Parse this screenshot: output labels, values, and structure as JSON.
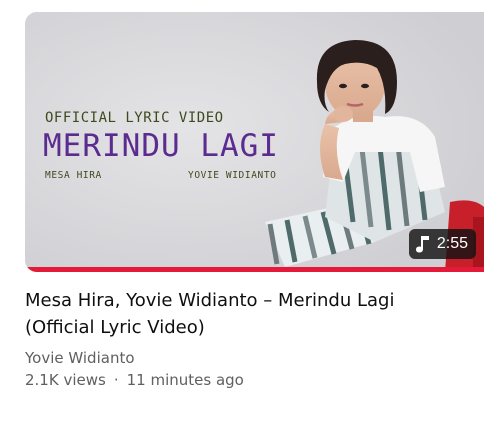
{
  "thumbnail": {
    "tag_line": "OFFICIAL LYRIC VIDEO",
    "song_title": "MERINDU LAGI",
    "artist_left": "MESA HIRA",
    "artist_right": "YOVIE WIDIANTO",
    "duration": "2:55",
    "duration_icon": "music-note-icon",
    "progress_fraction": 1.0,
    "progress_color": "#e5193a",
    "title_color": "#5b2b8f"
  },
  "video": {
    "title": "Mesa Hira, Yovie Widianto – Merindu Lagi (Official Lyric Video)",
    "channel": "Yovie Widianto",
    "views": "2.1K views",
    "separator": "·",
    "age": "11 minutes ago"
  }
}
